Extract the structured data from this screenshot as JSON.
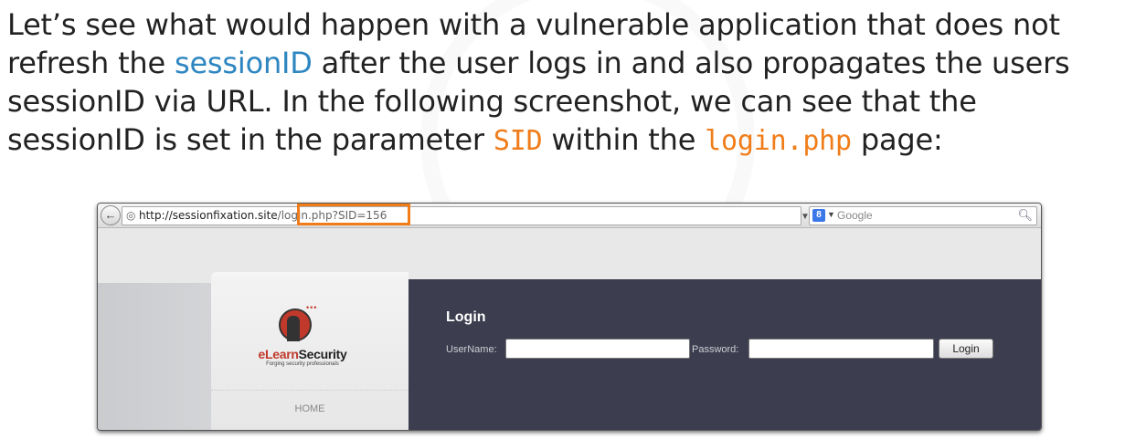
{
  "paragraph": {
    "part1": "Let’s see what would happen with a vulnerable application that does not refresh the ",
    "link_word": "sessionID",
    "part2": " after the user logs in and also propagates the users sessionID via URL. In the following screenshot, we can see that the sessionID is set in the parameter ",
    "param": "SID",
    "part3": " within the ",
    "page": "login.php",
    "part4": " page:"
  },
  "browser": {
    "url_host": "http://sessionfixation.site",
    "url_path": "/login.php?SID=156",
    "search_engine_label": "8",
    "search_placeholder": "Google"
  },
  "site": {
    "logo_text_a": "eLearn",
    "logo_text_b": "Security",
    "logo_tagline": "Forging security professionals",
    "nav_home": "HOME",
    "login_title": "Login",
    "username_label": "UserName:",
    "password_label": "Password:",
    "username_value": "",
    "password_value": "",
    "login_button": "Login"
  },
  "colors": {
    "highlight": "#f07d1a",
    "link_blue": "#2e86c1",
    "login_panel": "#3c3d4e"
  }
}
